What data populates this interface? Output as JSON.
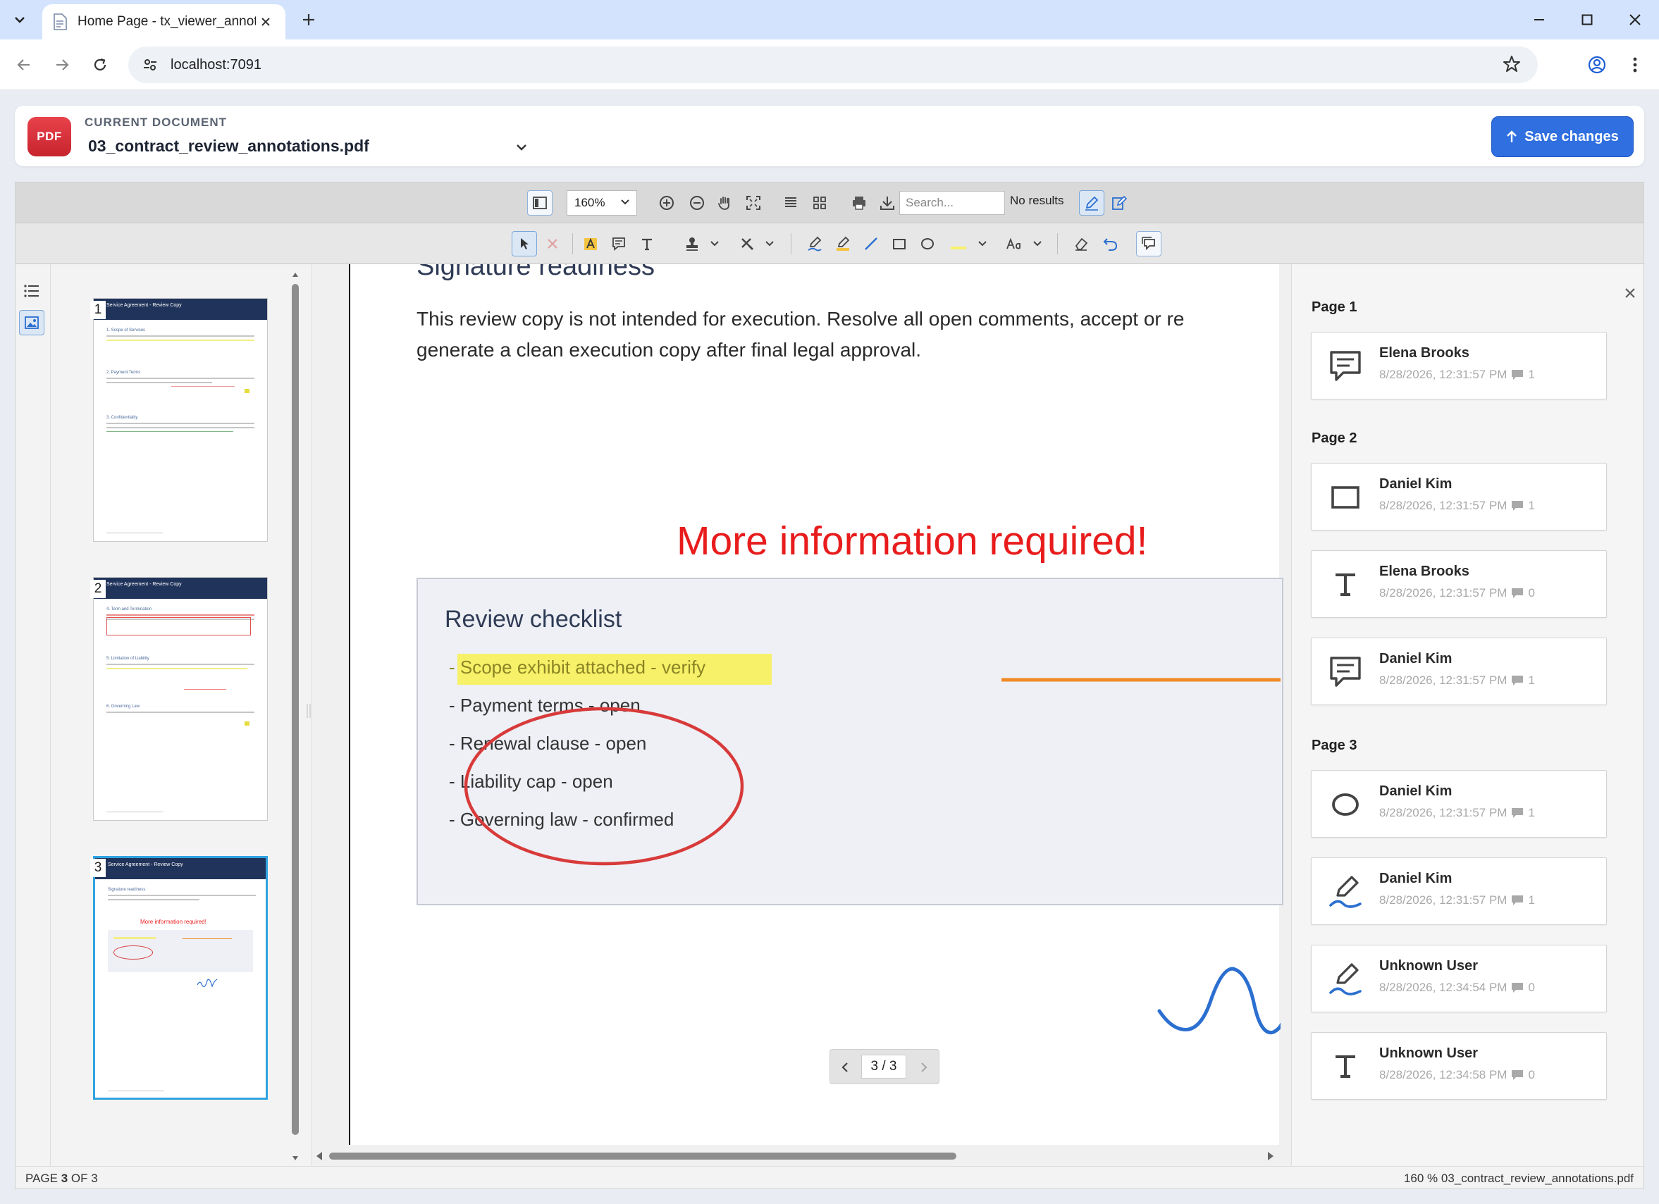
{
  "browser": {
    "tab_title": "Home Page - tx_viewer_annotat",
    "url": "localhost:7091"
  },
  "header": {
    "badge": "PDF",
    "label": "CURRENT DOCUMENT",
    "document_name": "03_contract_review_annotations.pdf",
    "save_label": "Save changes"
  },
  "toolbar": {
    "zoom": "160%",
    "search_placeholder": "Search...",
    "search_status": "No results"
  },
  "thumbnails": [
    {
      "number": "1",
      "title": "Service Agreement - Review Copy"
    },
    {
      "number": "2",
      "title": "Service Agreement - Review Copy"
    },
    {
      "number": "3",
      "title": "Service Agreement - Review Copy"
    }
  ],
  "page": {
    "section_title": "Signature readiness",
    "body_line1": "This review copy is not intended for execution. Resolve all open comments, accept or re",
    "body_line2": "generate a clean execution copy after final legal approval.",
    "free_text": "More information required!",
    "checklist_title": "Review checklist",
    "checklist": [
      "- Scope exhibit attached - verify",
      "- Payment terms - open",
      "- Renewal clause - open",
      "- Liability cap - open",
      "- Governing law - confirmed"
    ],
    "pager": "3 / 3"
  },
  "comments": {
    "groups": [
      {
        "page": "Page 1",
        "items": [
          {
            "author": "Elena Brooks",
            "time": "8/28/2026, 12:31:57 PM",
            "count": "1",
            "icon": "comment-icon"
          }
        ]
      },
      {
        "page": "Page 2",
        "items": [
          {
            "author": "Daniel Kim",
            "time": "8/28/2026, 12:31:57 PM",
            "count": "1",
            "icon": "rectangle-icon"
          },
          {
            "author": "Elena Brooks",
            "time": "8/28/2026, 12:31:57 PM",
            "count": "0",
            "icon": "text-icon"
          },
          {
            "author": "Daniel Kim",
            "time": "8/28/2026, 12:31:57 PM",
            "count": "1",
            "icon": "comment-icon"
          }
        ]
      },
      {
        "page": "Page 3",
        "items": [
          {
            "author": "Daniel Kim",
            "time": "8/28/2026, 12:31:57 PM",
            "count": "1",
            "icon": "ellipse-icon"
          },
          {
            "author": "Daniel Kim",
            "time": "8/28/2026, 12:31:57 PM",
            "count": "1",
            "icon": "ink-icon"
          },
          {
            "author": "Unknown User",
            "time": "8/28/2026, 12:34:54 PM",
            "count": "0",
            "icon": "ink-icon"
          },
          {
            "author": "Unknown User",
            "time": "8/28/2026, 12:34:58 PM",
            "count": "0",
            "icon": "text-icon"
          }
        ]
      }
    ]
  },
  "status": {
    "page_prefix": "PAGE",
    "page_current": "3",
    "page_of": "OF 3",
    "right": "160 %  03_contract_review_annotations.pdf"
  },
  "colors": {
    "accent": "#2f6fe0",
    "free_text": "#e81c1c",
    "highlight": "#f7f16a",
    "ellipse": "#d83a3a",
    "line": "#f08a24",
    "ink": "#2b6fd0"
  }
}
